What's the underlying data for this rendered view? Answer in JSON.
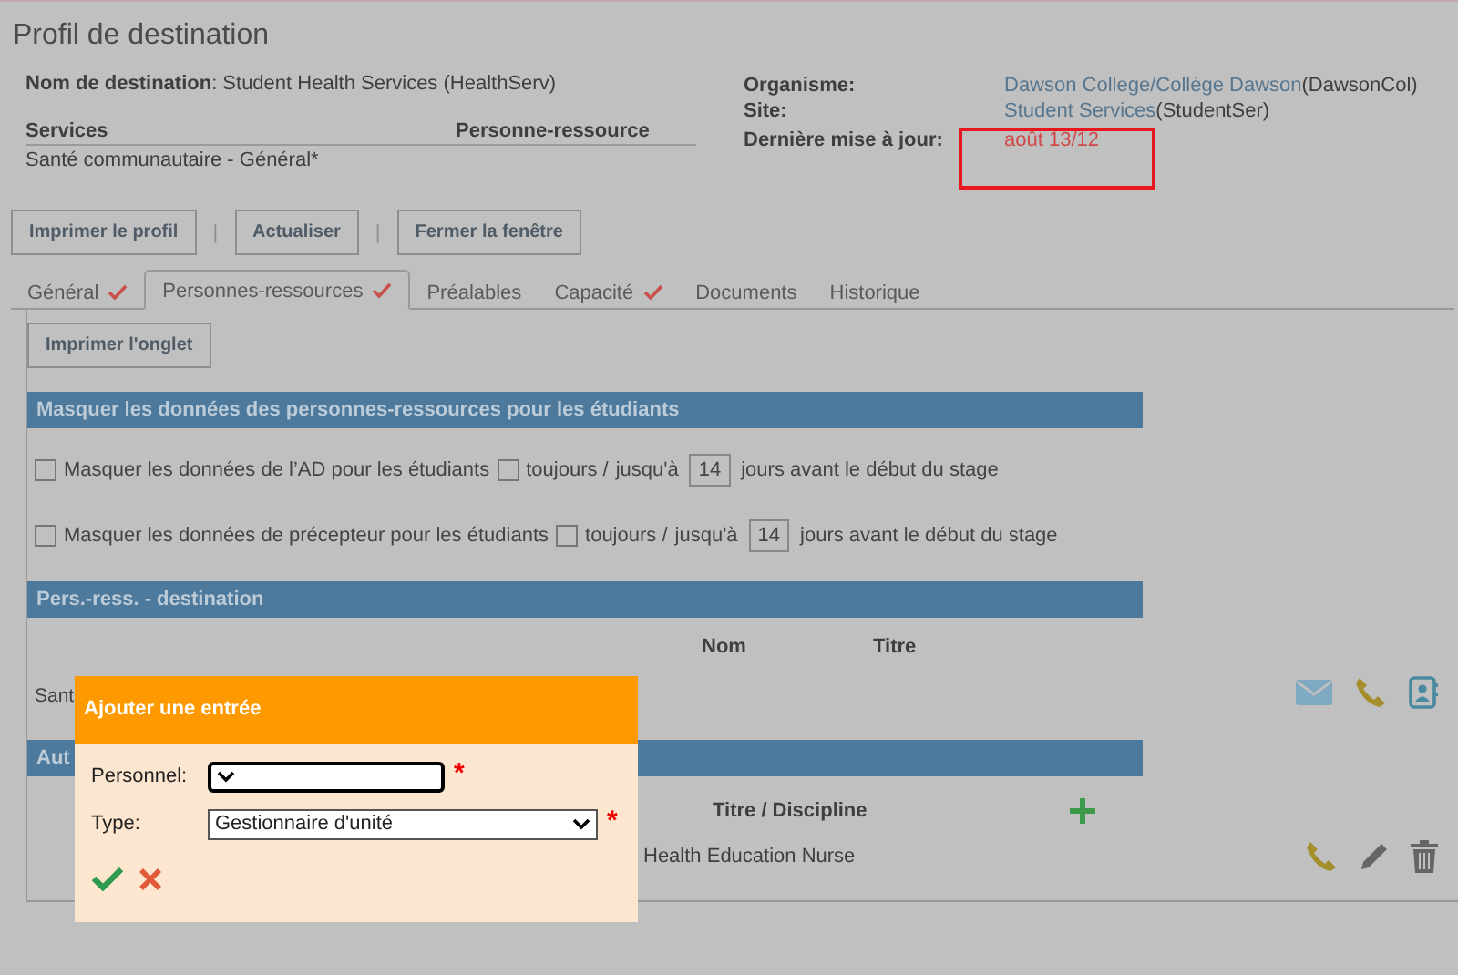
{
  "title": "Profil de destination",
  "destination": {
    "label": "Nom de destination",
    "value": ": Student Health Services (HealthServ)"
  },
  "services_table": {
    "columns": [
      "Services",
      "Personne-ressource"
    ],
    "rows": [
      {
        "service": "Santé communautaire - Général*"
      }
    ]
  },
  "details": [
    {
      "kind": "link",
      "label": "Organisme:",
      "link": "Dawson College/Collège Dawson",
      "code": "(DawsonCol)"
    },
    {
      "kind": "link",
      "label": "Site:",
      "link": "Student Services",
      "code": "(StudentSer)"
    },
    {
      "kind": "date",
      "label": "Dernière mise à jour:",
      "value": "août 13/12"
    }
  ],
  "toolbar": [
    {
      "kind": "button",
      "label": "Imprimer le profil"
    },
    {
      "kind": "separator",
      "label": "|"
    },
    {
      "kind": "button",
      "label": "Actualiser"
    },
    {
      "kind": "separator",
      "label": "|"
    },
    {
      "kind": "button",
      "label": "Fermer la fenêtre"
    }
  ],
  "tabs": [
    {
      "label": "Général",
      "checked": true,
      "selected": false
    },
    {
      "label": "Personnes-ressources",
      "checked": true,
      "selected": true
    },
    {
      "label": "Préalables",
      "checked": false,
      "selected": false
    },
    {
      "label": "Capacité",
      "checked": true,
      "selected": false
    },
    {
      "label": "Documents",
      "checked": false,
      "selected": false
    },
    {
      "label": "Historique",
      "checked": false,
      "selected": false
    }
  ],
  "print_tab_button": "Imprimer l'onglet",
  "hide_section": {
    "title": "Masquer les données des personnes-ressources pour les étudiants",
    "rows": [
      {
        "label": "Masquer les données de l’AD pour les étudiants",
        "checked": false,
        "always": "toujours /",
        "always_checked": false,
        "until": "jusqu'à",
        "days": "14",
        "suffix": "jours avant le début du stage"
      },
      {
        "label": "Masquer les données de précepteur pour les étudiants",
        "checked": false,
        "always": "toujours /",
        "always_checked": false,
        "until": "jusqu'à",
        "days": "14",
        "suffix": "jours avant le début du stage"
      }
    ]
  },
  "destination_contacts": {
    "title": "Pers.-ress. - destination",
    "columns": [
      "Nom",
      "Titre"
    ],
    "row": {
      "column_1": "Sant"
    }
  },
  "other_contacts": {
    "title": "Aut",
    "columns": [
      "Titre / Discipline"
    ],
    "row": {
      "title": "Health Education Nurse"
    }
  },
  "modal": {
    "title": "Ajouter une entrée",
    "fields": [
      {
        "label": "Personnel:",
        "required_mark": "*",
        "focused": true
      },
      {
        "label": "Type:",
        "value": "Gestionnaire d'unité",
        "required_mark": "*",
        "focused": false
      }
    ]
  }
}
